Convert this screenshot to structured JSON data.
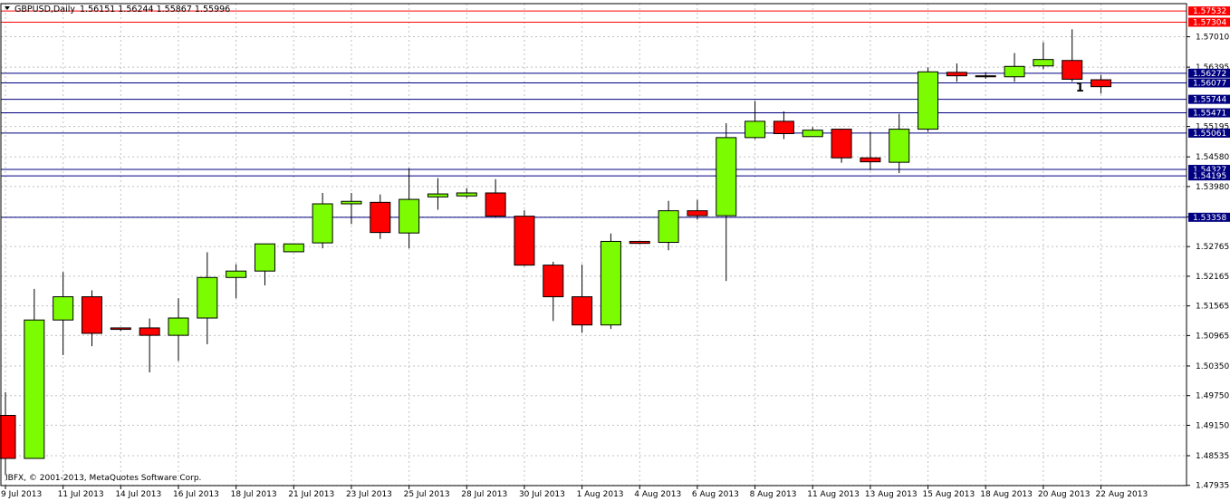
{
  "chart_data": {
    "type": "candlestick",
    "header": {
      "symbol": "GBPUSD,Daily",
      "ohlc": "1.56151 1.56244 1.55867 1.55996"
    },
    "copyright": "IBFX, © 2001-2013, MetaQuotes Software Corp.",
    "ylim": [
      1.4793,
      1.5768
    ],
    "y_ticks": [
      "1.57010",
      "1.56395",
      "1.55195",
      "1.54580",
      "1.53980",
      "1.53365",
      "1.52765",
      "1.52165",
      "1.51565",
      "1.50965",
      "1.50350",
      "1.49750",
      "1.49150",
      "1.48535",
      "1.47935"
    ],
    "x_ticks": [
      {
        "index": 0,
        "label": "9 Jul 2013"
      },
      {
        "index": 2,
        "label": "11 Jul 2013"
      },
      {
        "index": 4,
        "label": "14 Jul 2013"
      },
      {
        "index": 6,
        "label": "16 Jul 2013"
      },
      {
        "index": 8,
        "label": "18 Jul 2013"
      },
      {
        "index": 10,
        "label": "21 Jul 2013"
      },
      {
        "index": 12,
        "label": "23 Jul 2013"
      },
      {
        "index": 14,
        "label": "25 Jul 2013"
      },
      {
        "index": 16,
        "label": "28 Jul 2013"
      },
      {
        "index": 18,
        "label": "30 Jul 2013"
      },
      {
        "index": 20,
        "label": "1 Aug 2013"
      },
      {
        "index": 22,
        "label": "4 Aug 2013"
      },
      {
        "index": 24,
        "label": "6 Aug 2013"
      },
      {
        "index": 26,
        "label": "8 Aug 2013"
      },
      {
        "index": 28,
        "label": "11 Aug 2013"
      },
      {
        "index": 30,
        "label": "13 Aug 2013"
      },
      {
        "index": 32,
        "label": "15 Aug 2013"
      },
      {
        "index": 34,
        "label": "18 Aug 2013"
      },
      {
        "index": 36,
        "label": "20 Aug 2013"
      },
      {
        "index": 38,
        "label": "22 Aug 2013"
      }
    ],
    "candles": [
      {
        "o": 1.4935,
        "h": 1.4982,
        "l": 1.4815,
        "c": 1.4848
      },
      {
        "o": 1.4848,
        "h": 1.5191,
        "l": 1.4848,
        "c": 1.5128
      },
      {
        "o": 1.5128,
        "h": 1.5225,
        "l": 1.5057,
        "c": 1.5175
      },
      {
        "o": 1.5175,
        "h": 1.5188,
        "l": 1.5075,
        "c": 1.5101
      },
      {
        "o": 1.5112,
        "h": 1.5112,
        "l": 1.5106,
        "c": 1.5109
      },
      {
        "o": 1.5112,
        "h": 1.5131,
        "l": 1.5022,
        "c": 1.5097
      },
      {
        "o": 1.5097,
        "h": 1.5172,
        "l": 1.5045,
        "c": 1.5132
      },
      {
        "o": 1.5132,
        "h": 1.5265,
        "l": 1.5079,
        "c": 1.5214
      },
      {
        "o": 1.5214,
        "h": 1.5241,
        "l": 1.5172,
        "c": 1.5227
      },
      {
        "o": 1.5227,
        "h": 1.5281,
        "l": 1.5198,
        "c": 1.5282
      },
      {
        "o": 1.5266,
        "h": 1.5283,
        "l": 1.5266,
        "c": 1.5282
      },
      {
        "o": 1.5284,
        "h": 1.5385,
        "l": 1.5273,
        "c": 1.5363
      },
      {
        "o": 1.5363,
        "h": 1.5385,
        "l": 1.5322,
        "c": 1.5368
      },
      {
        "o": 1.5366,
        "h": 1.5382,
        "l": 1.5292,
        "c": 1.5305
      },
      {
        "o": 1.5304,
        "h": 1.5435,
        "l": 1.5273,
        "c": 1.5372
      },
      {
        "o": 1.5377,
        "h": 1.5415,
        "l": 1.5351,
        "c": 1.5383
      },
      {
        "o": 1.5379,
        "h": 1.5395,
        "l": 1.5375,
        "c": 1.5385
      },
      {
        "o": 1.5385,
        "h": 1.5413,
        "l": 1.5335,
        "c": 1.5338
      },
      {
        "o": 1.5338,
        "h": 1.535,
        "l": 1.5237,
        "c": 1.5239
      },
      {
        "o": 1.5239,
        "h": 1.5246,
        "l": 1.5126,
        "c": 1.5175
      },
      {
        "o": 1.5175,
        "h": 1.524,
        "l": 1.5102,
        "c": 1.5118
      },
      {
        "o": 1.5118,
        "h": 1.5303,
        "l": 1.511,
        "c": 1.5287
      },
      {
        "o": 1.5287,
        "h": 1.5288,
        "l": 1.5282,
        "c": 1.5283
      },
      {
        "o": 1.5285,
        "h": 1.5369,
        "l": 1.5269,
        "c": 1.5349
      },
      {
        "o": 1.5349,
        "h": 1.5371,
        "l": 1.5331,
        "c": 1.5339
      },
      {
        "o": 1.5339,
        "h": 1.5526,
        "l": 1.5207,
        "c": 1.5497
      },
      {
        "o": 1.5497,
        "h": 1.5571,
        "l": 1.5494,
        "c": 1.553
      },
      {
        "o": 1.553,
        "h": 1.555,
        "l": 1.5494,
        "c": 1.5505
      },
      {
        "o": 1.5499,
        "h": 1.5518,
        "l": 1.5499,
        "c": 1.5512
      },
      {
        "o": 1.5514,
        "h": 1.5515,
        "l": 1.5446,
        "c": 1.5456
      },
      {
        "o": 1.5456,
        "h": 1.5508,
        "l": 1.5431,
        "c": 1.5448
      },
      {
        "o": 1.5447,
        "h": 1.5545,
        "l": 1.5425,
        "c": 1.5514
      },
      {
        "o": 1.5514,
        "h": 1.5639,
        "l": 1.5509,
        "c": 1.563
      },
      {
        "o": 1.5629,
        "h": 1.5647,
        "l": 1.561,
        "c": 1.5622
      },
      {
        "o": 1.5622,
        "h": 1.5629,
        "l": 1.5616,
        "c": 1.562
      },
      {
        "o": 1.562,
        "h": 1.5668,
        "l": 1.561,
        "c": 1.5641
      },
      {
        "o": 1.5642,
        "h": 1.569,
        "l": 1.5635,
        "c": 1.5655
      },
      {
        "o": 1.5653,
        "h": 1.5716,
        "l": 1.561,
        "c": 1.5615
      },
      {
        "o": 1.5614,
        "h": 1.5624,
        "l": 1.5586,
        "c": 1.56
      }
    ],
    "levels": [
      {
        "value": 1.57532,
        "label": "1.57532",
        "color": "#ff0000"
      },
      {
        "value": 1.57304,
        "label": "1.57304",
        "color": "#ff0000"
      },
      {
        "value": 1.56272,
        "label": "1.56272",
        "color": "#000080"
      },
      {
        "value": 1.56077,
        "label": "1.56077",
        "color": "#000080"
      },
      {
        "value": 1.55744,
        "label": "1.55744",
        "color": "#000080"
      },
      {
        "value": 1.55471,
        "label": "1.55471",
        "color": "#000080"
      },
      {
        "value": 1.55061,
        "label": "1.55061",
        "color": "#000080"
      },
      {
        "value": 1.54327,
        "label": "1.54327",
        "color": "#000080"
      },
      {
        "value": 1.54195,
        "label": "1.54195",
        "color": "#000080"
      },
      {
        "value": 1.53358,
        "label": "1.53358",
        "color": "#000080"
      }
    ],
    "annotations": [
      {
        "index": 37,
        "value": 1.559,
        "text": "1"
      }
    ],
    "colors": {
      "bull": "#7cfc00",
      "bear": "#ff0000",
      "outline": "#000000",
      "grid": "#c0c0c0"
    }
  }
}
